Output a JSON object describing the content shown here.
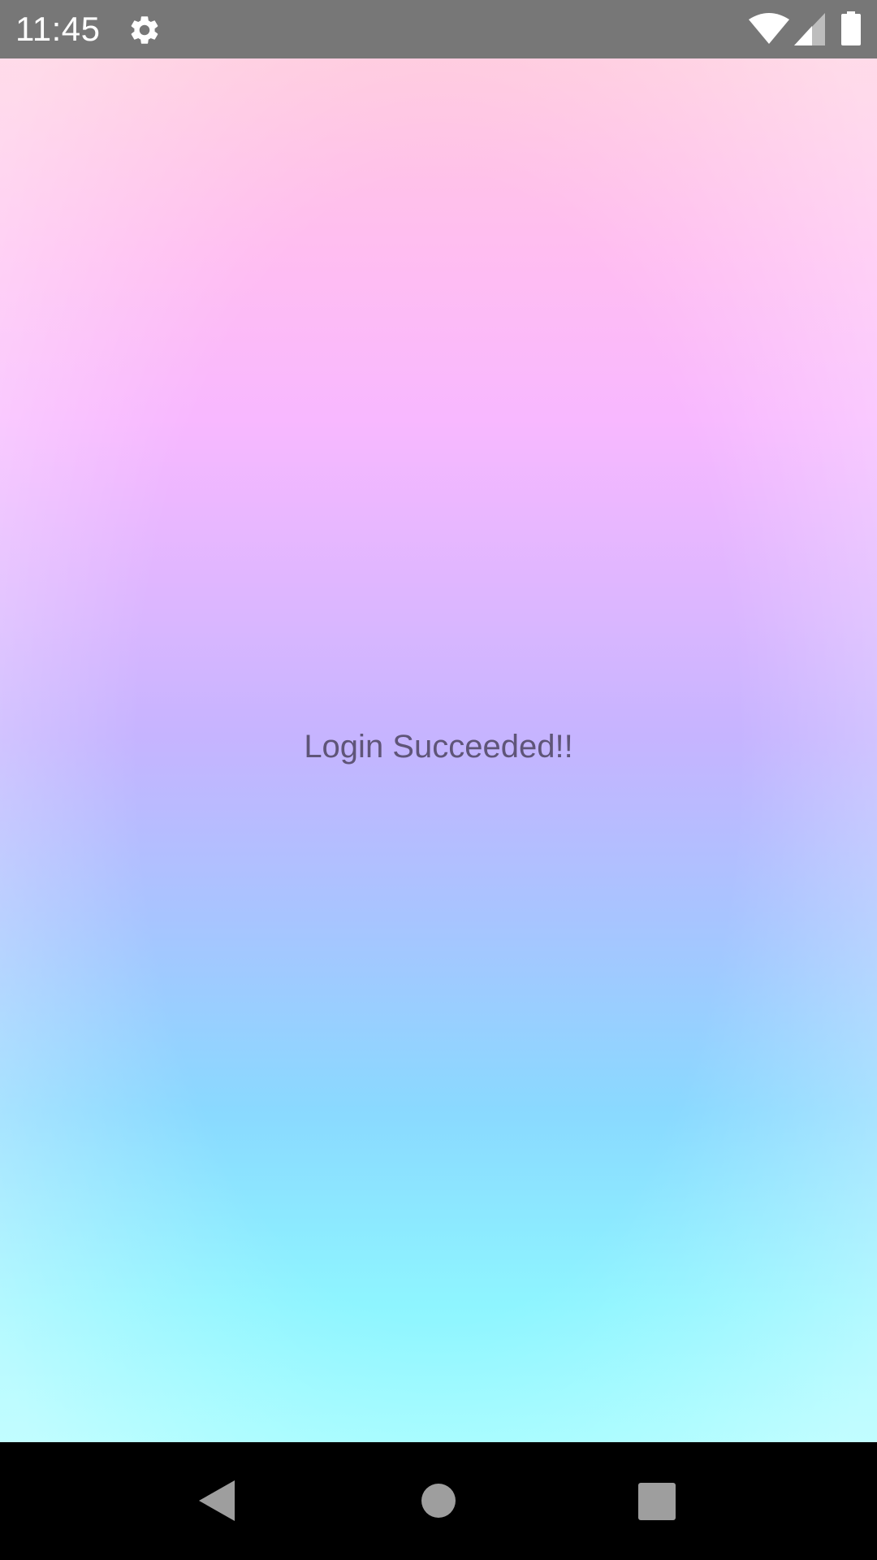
{
  "status_bar": {
    "time": "11:45",
    "background_color": "#777777",
    "icons": [
      "gear-icon",
      "wifi-icon",
      "cell-signal-icon",
      "battery-icon"
    ]
  },
  "content": {
    "message": "Login Succeeded!!",
    "text_color": "#5f5578",
    "gradient_colors": [
      "#ffc8dd",
      "#f8b8ff",
      "#c6b4ff",
      "#8ad9ff",
      "#a0fcff"
    ]
  },
  "nav_bar": {
    "background_color": "#000000",
    "icons": [
      "back-icon",
      "home-icon",
      "recents-icon"
    ]
  }
}
